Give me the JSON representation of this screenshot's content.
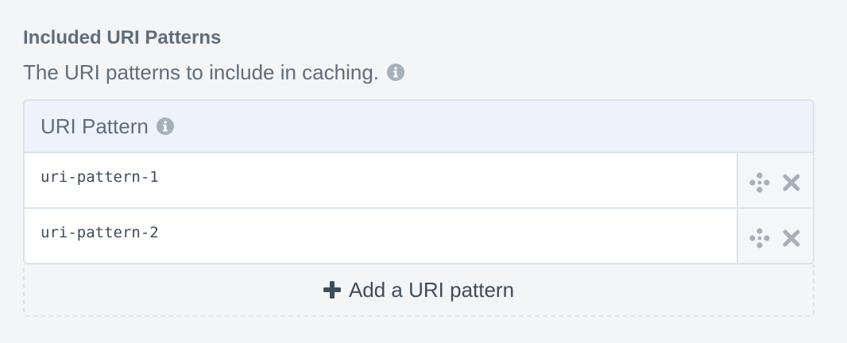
{
  "field": {
    "title": "Included URI Patterns",
    "instructions": "The URI patterns to include in caching."
  },
  "table": {
    "column_header": "URI Pattern",
    "rows": [
      {
        "value": "uri-pattern-1"
      },
      {
        "value": "uri-pattern-2"
      }
    ],
    "row_actions": [
      "move-icon",
      "delete-icon"
    ]
  },
  "add_button": {
    "label": "Add a URI pattern",
    "icon": "plus-icon"
  },
  "colors": {
    "background": "#f3f5f7",
    "border": "#dbe3ea",
    "header_bg": "#eef3fb",
    "text": "#3f4d5a",
    "muted_text": "#606d7b",
    "icon": "#a6b0bb"
  }
}
